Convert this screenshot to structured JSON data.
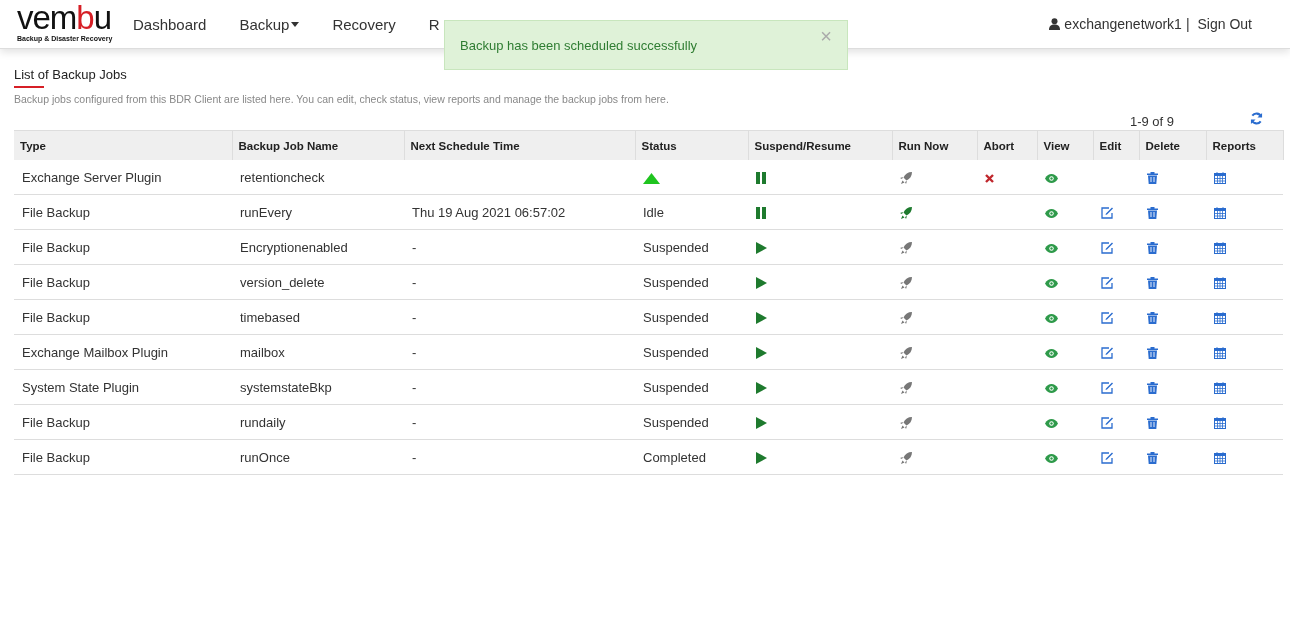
{
  "logo": {
    "parts": [
      {
        "text": "vem",
        "accent": false
      },
      {
        "text": "b",
        "accent": true
      },
      {
        "text": "u",
        "accent": false
      }
    ],
    "tagline": "Backup & Disaster Recovery"
  },
  "nav": [
    {
      "label": "Dashboard",
      "dropdown": false
    },
    {
      "label": "Backup",
      "dropdown": true
    },
    {
      "label": "Recovery",
      "dropdown": false
    },
    {
      "label": "R",
      "dropdown": false
    }
  ],
  "user": {
    "name": "exchangenetwork1",
    "separator": "|",
    "sign_out": "Sign Out"
  },
  "toast": {
    "message": "Backup has been scheduled successfully",
    "close": "×"
  },
  "page": {
    "title": "List of Backup Jobs",
    "description": "Backup jobs configured from this BDR Client are listed here. You can edit, check status, view reports and manage the backup jobs from here."
  },
  "pagination": "1-9 of 9",
  "columns": [
    "Type",
    "Backup Job Name",
    "Next Schedule Time",
    "Status",
    "Suspend/Resume",
    "Run Now",
    "Abort",
    "View",
    "Edit",
    "Delete",
    "Reports"
  ],
  "rows": [
    {
      "type": "Exchange Server Plugin",
      "name": "retentioncheck",
      "next": "",
      "status": "",
      "running": true,
      "suspended": false,
      "run_now_enabled": false,
      "abort": true,
      "edit": false
    },
    {
      "type": "File Backup",
      "name": "runEvery",
      "next": "Thu 19 Aug 2021 06:57:02",
      "status": "Idle",
      "running": false,
      "suspended": false,
      "run_now_enabled": true,
      "abort": false,
      "edit": true
    },
    {
      "type": "File Backup",
      "name": "Encryptionenabled",
      "next": "-",
      "status": "Suspended",
      "running": false,
      "suspended": true,
      "run_now_enabled": false,
      "abort": false,
      "edit": true
    },
    {
      "type": "File Backup",
      "name": "version_delete",
      "next": "-",
      "status": "Suspended",
      "running": false,
      "suspended": true,
      "run_now_enabled": false,
      "abort": false,
      "edit": true
    },
    {
      "type": "File Backup",
      "name": "timebased",
      "next": "-",
      "status": "Suspended",
      "running": false,
      "suspended": true,
      "run_now_enabled": false,
      "abort": false,
      "edit": true
    },
    {
      "type": "Exchange Mailbox Plugin",
      "name": "mailbox",
      "next": "-",
      "status": "Suspended",
      "running": false,
      "suspended": true,
      "run_now_enabled": false,
      "abort": false,
      "edit": true
    },
    {
      "type": "System State Plugin",
      "name": "systemstateBkp",
      "next": "-",
      "status": "Suspended",
      "running": false,
      "suspended": true,
      "run_now_enabled": false,
      "abort": false,
      "edit": true
    },
    {
      "type": "File Backup",
      "name": "rundaily",
      "next": "-",
      "status": "Suspended",
      "running": false,
      "suspended": true,
      "run_now_enabled": false,
      "abort": false,
      "edit": true
    },
    {
      "type": "File Backup",
      "name": "runOnce",
      "next": "-",
      "status": "Completed",
      "running": false,
      "suspended": true,
      "run_now_enabled": false,
      "abort": false,
      "edit": true
    }
  ]
}
